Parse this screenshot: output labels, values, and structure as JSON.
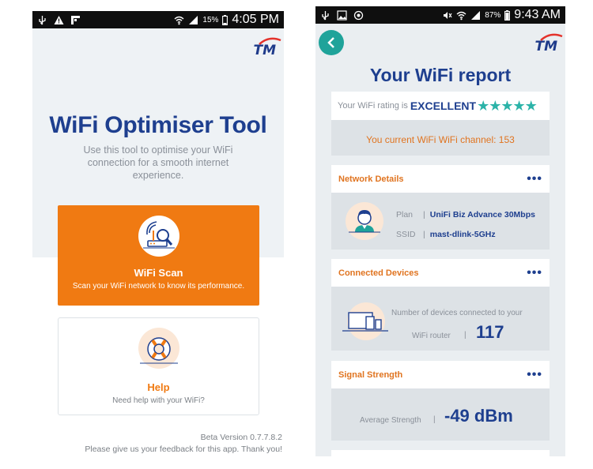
{
  "left": {
    "status": {
      "time": "4:05 PM",
      "battery": "15%"
    },
    "logo": "TM",
    "title": "WiFi Optimiser Tool",
    "description": "Use this tool to optimise your WiFi connection for a smooth internet experience.",
    "scan": {
      "title": "WiFi Scan",
      "subtitle": "Scan your WiFi network to know its performance."
    },
    "help": {
      "title": "Help",
      "subtitle": "Need help with your WiFi?"
    },
    "version": "Beta Version 0.7.7.8.2",
    "feedback": "Please give us your feedback for this app. Thank you!"
  },
  "right": {
    "status": {
      "time": "9:43 AM",
      "battery": "87%"
    },
    "logo": "TM",
    "title": "Your WiFi report",
    "rating": {
      "label": "Your WiFi rating is",
      "value": "EXCELLENT",
      "stars": "★★★★★",
      "stars_count": 5
    },
    "channel_text": "You current WiFi WiFi channel: 153",
    "network": {
      "header": "Network Details",
      "plan_label": "Plan",
      "plan_value": "UniFi Biz Advance 30Mbps",
      "ssid_label": "SSID",
      "ssid_value": "mast-dlink-5GHz"
    },
    "devices": {
      "header": "Connected Devices",
      "line1": "Number of devices connected to your",
      "line2": "WiFi router",
      "count": "117"
    },
    "signal": {
      "header": "Signal Strength",
      "label": "Average Strength",
      "value": "-49 dBm"
    },
    "more_icon": "•••",
    "separator": "|"
  },
  "colors": {
    "brand_blue": "#1e3f8f",
    "orange": "#f07a12",
    "teal": "#1fa39a",
    "star": "#2bb3a8"
  }
}
